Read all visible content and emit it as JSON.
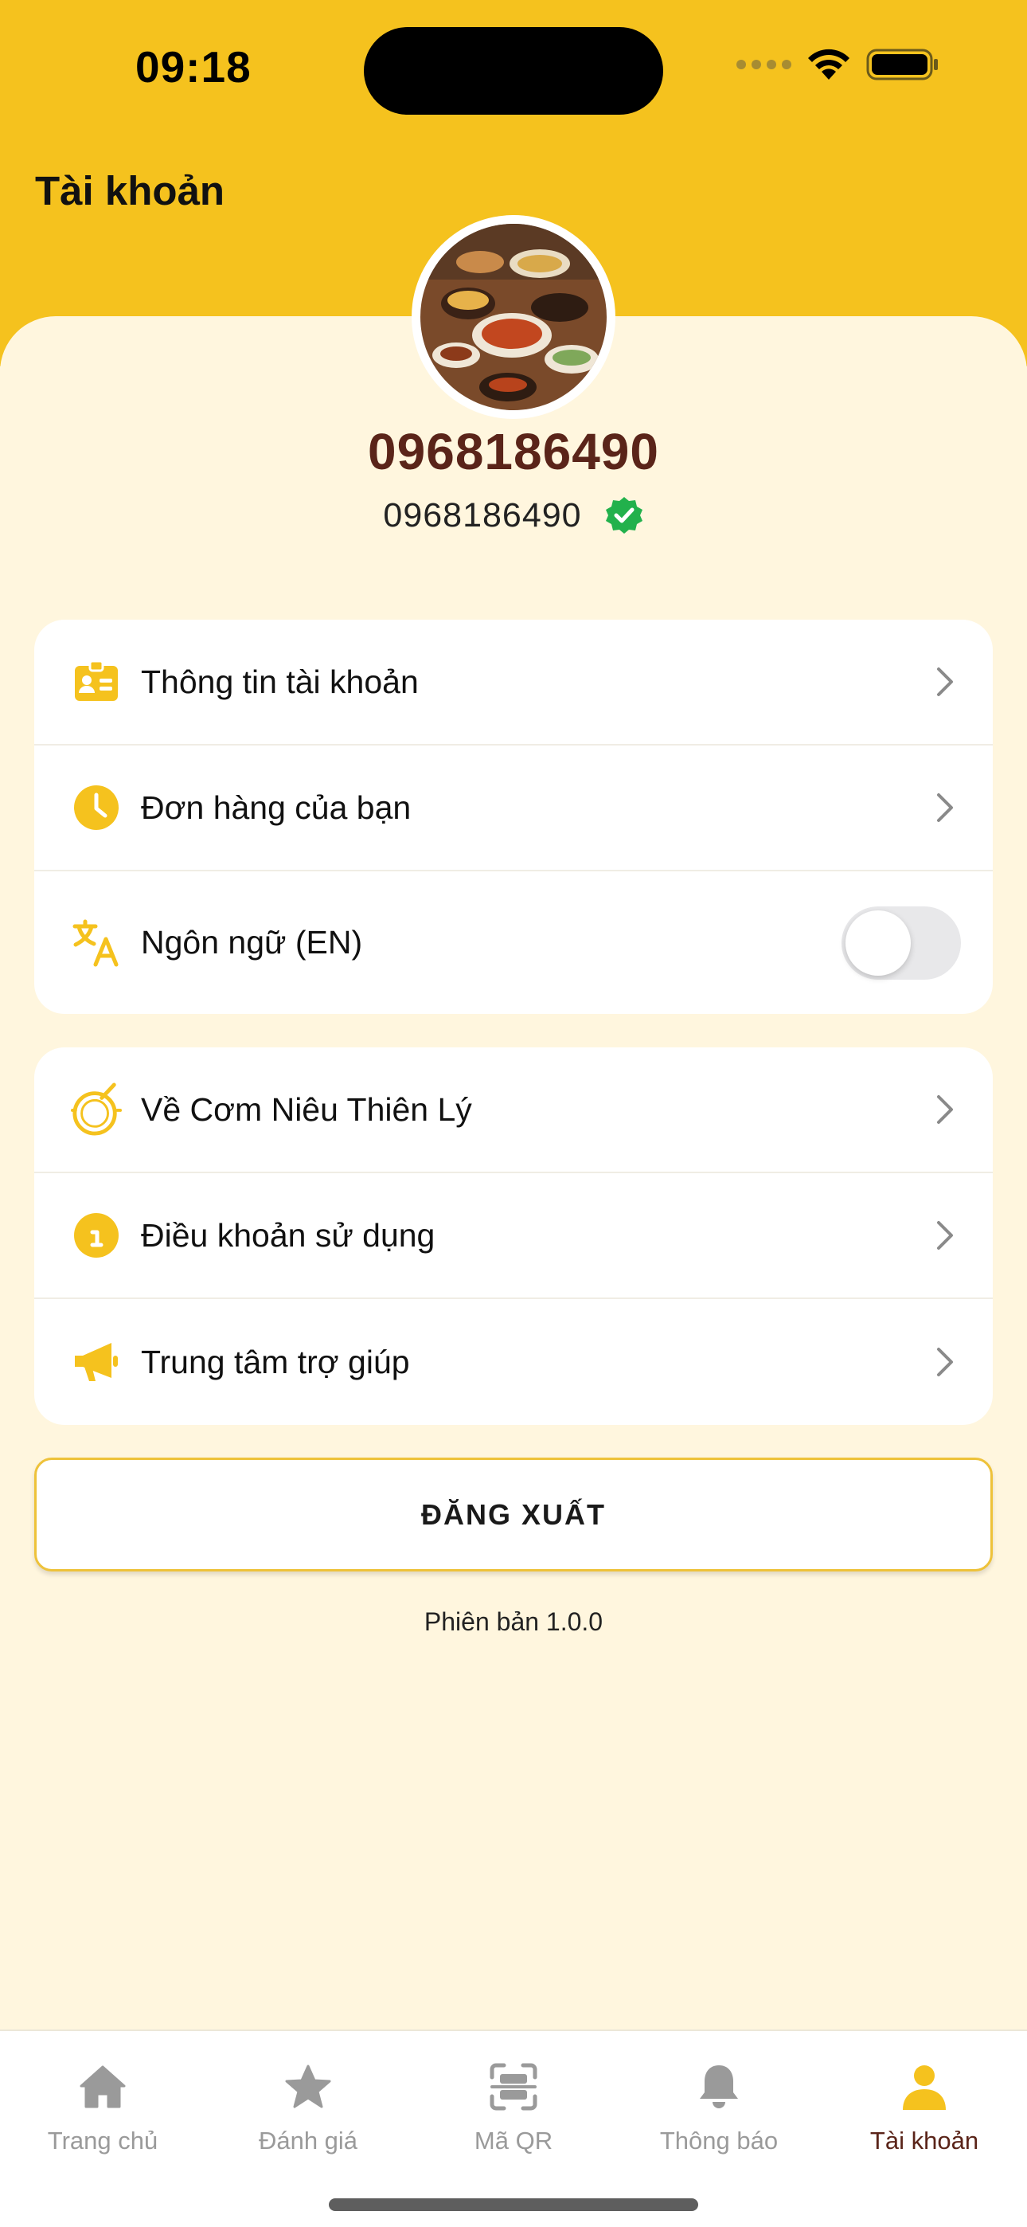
{
  "status_bar": {
    "time": "09:18"
  },
  "header": {
    "title": "Tài khoản"
  },
  "profile": {
    "name": "0968186490",
    "phone": "0968186490",
    "verified_icon": "check-circle-icon"
  },
  "menu_group_1": [
    {
      "label": "Thông tin tài khoản",
      "icon": "id-card-icon"
    },
    {
      "label": "Đơn hàng của bạn",
      "icon": "clock-icon"
    },
    {
      "label": "Ngôn ngữ (EN)",
      "icon": "translate-icon",
      "toggle_on": false
    }
  ],
  "menu_group_2": [
    {
      "label": "Về Cơm Niêu Thiên Lý",
      "icon": "clay-pot-icon"
    },
    {
      "label": "Điều khoản sử dụng",
      "icon": "info-icon"
    },
    {
      "label": "Trung tâm trợ giúp",
      "icon": "megaphone-icon"
    }
  ],
  "logout_label": "ĐĂNG XUẤT",
  "version": "Phiên bản 1.0.0",
  "tabs": [
    {
      "label": "Trang chủ",
      "icon": "home-icon"
    },
    {
      "label": "Đánh giá",
      "icon": "star-icon"
    },
    {
      "label": "Mã QR",
      "icon": "qr-scan-icon"
    },
    {
      "label": "Thông báo",
      "icon": "bell-icon"
    },
    {
      "label": "Tài khoản",
      "icon": "user-icon",
      "active": true
    }
  ],
  "colors": {
    "primary": "#F5C21E",
    "accent": "#5A2419",
    "background": "#FFF6DE",
    "verified": "#22B14C"
  }
}
